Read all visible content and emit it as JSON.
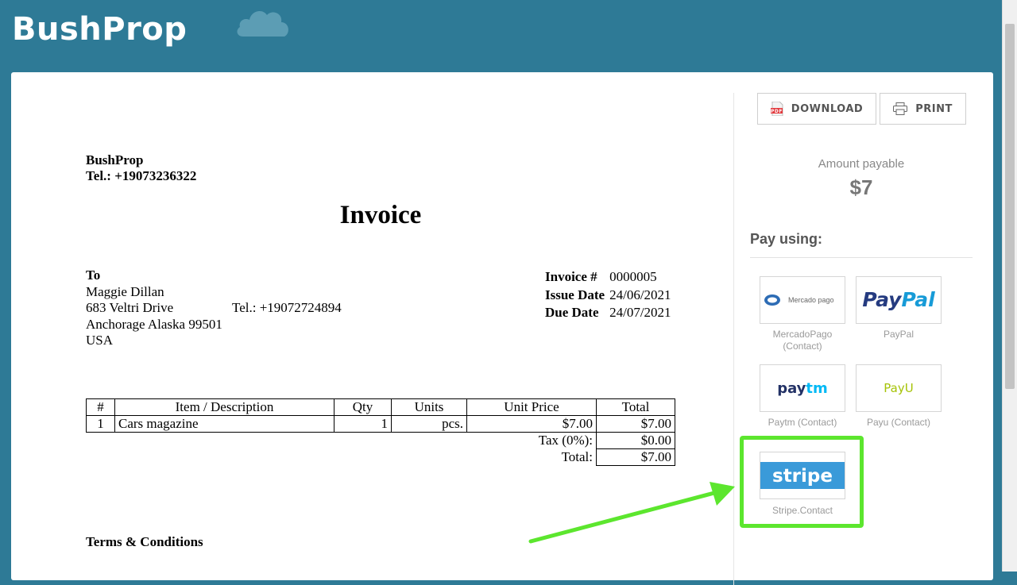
{
  "header": {
    "brand": "BushProp"
  },
  "invoice": {
    "seller_name": "BushProp",
    "seller_tel": "Tel.: +19073236322",
    "title": "Invoice",
    "to_label": "To",
    "customer_name": "Maggie Dillan",
    "customer_street": "683 Veltri Drive",
    "customer_tel": "Tel.: +19072724894",
    "customer_city": "Anchorage Alaska 99501",
    "customer_country": "USA",
    "invoice_no_label": "Invoice #",
    "invoice_no": "0000005",
    "issue_date_label": "Issue Date",
    "issue_date": "24/06/2021",
    "due_date_label": "Due Date",
    "due_date": "24/07/2021",
    "columns": [
      "#",
      "Item / Description",
      "Qty",
      "Units",
      "Unit Price",
      "Total"
    ],
    "rows": [
      {
        "num": "1",
        "desc": "Cars magazine",
        "qty": "1",
        "units": "pcs.",
        "unit_price": "$7.00",
        "total": "$7.00"
      }
    ],
    "tax_label": "Tax (0%):",
    "tax_value": "$0.00",
    "total_label": "Total:",
    "total_value": "$7.00",
    "terms_label": "Terms & Conditions"
  },
  "sidebar": {
    "download_label": "DOWNLOAD",
    "print_label": "PRINT",
    "pdf_badge": "PDF",
    "amount_label": "Amount payable",
    "amount_value": "$7",
    "pay_using": "Pay using:",
    "methods": [
      {
        "logo": "Mercado pago",
        "caption": "MercadoPago (Contact)"
      },
      {
        "logo": "PayPal",
        "caption": "PayPal"
      },
      {
        "logo": "paytm",
        "caption": "Paytm (Contact)"
      },
      {
        "logo": "PayU",
        "caption": "Payu (Contact)"
      },
      {
        "logo": "stripe",
        "caption": "Stripe.Contact"
      }
    ]
  },
  "colors": {
    "header_bg": "#2e7a96",
    "highlight": "#5ce62e",
    "stripe": "#3a9ad9",
    "paypal_dark": "#253b80",
    "paypal_light": "#179bd7"
  }
}
